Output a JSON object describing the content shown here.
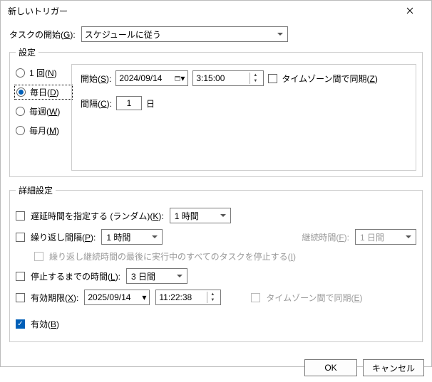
{
  "title": "新しいトリガー",
  "begin_label_pre": "タスクの開始(",
  "begin_label_key": "G",
  "begin_label_post": "):",
  "begin_value": "スケジュールに従う",
  "settings_legend": "設定",
  "radios": {
    "once_pre": "1 回(",
    "once_key": "N",
    "once_post": ")",
    "daily_pre": "毎日(",
    "daily_key": "D",
    "daily_post": ")",
    "weekly_pre": "毎週(",
    "weekly_key": "W",
    "weekly_post": ")",
    "monthly_pre": "毎月(",
    "monthly_key": "M",
    "monthly_post": ")"
  },
  "start_label_pre": "開始(",
  "start_label_key": "S",
  "start_label_post": "):",
  "start_date": "2024/09/14",
  "start_time": "3:15:00",
  "sync_tz_pre": "タイムゾーン間で同期(",
  "sync_tz_key": "Z",
  "sync_tz_post": ")",
  "interval_label_pre": "間隔(",
  "interval_label_key": "C",
  "interval_label_post": "):",
  "interval_value": "1",
  "interval_unit": "日",
  "adv_legend": "詳細設定",
  "delay_pre": "遅延時間を指定する (ランダム)(",
  "delay_key": "K",
  "delay_post": "):",
  "delay_value": "1 時間",
  "repeat_pre": "繰り返し間隔(",
  "repeat_key": "P",
  "repeat_post": "):",
  "repeat_value": "1 時間",
  "duration_label_pre": "継続時間(",
  "duration_label_key": "F",
  "duration_label_post": "):",
  "duration_value": "1 日間",
  "stop_at_end_pre": "繰り返し継続時間の最後に実行中のすべてのタスクを停止する(",
  "stop_at_end_key": "I",
  "stop_at_end_post": ")",
  "stop_after_pre": "停止するまでの時間(",
  "stop_after_key": "L",
  "stop_after_post": "):",
  "stop_after_value": "3 日間",
  "expire_pre": "有効期限(",
  "expire_key": "X",
  "expire_post": "):",
  "expire_date": "2025/09/14",
  "expire_time": "11:22:38",
  "expire_sync_pre": "タイムゾーン間で同期(",
  "expire_sync_key": "E",
  "expire_sync_post": ")",
  "enabled_pre": "有効(",
  "enabled_key": "B",
  "enabled_post": ")",
  "ok": "OK",
  "cancel": "キャンセル"
}
